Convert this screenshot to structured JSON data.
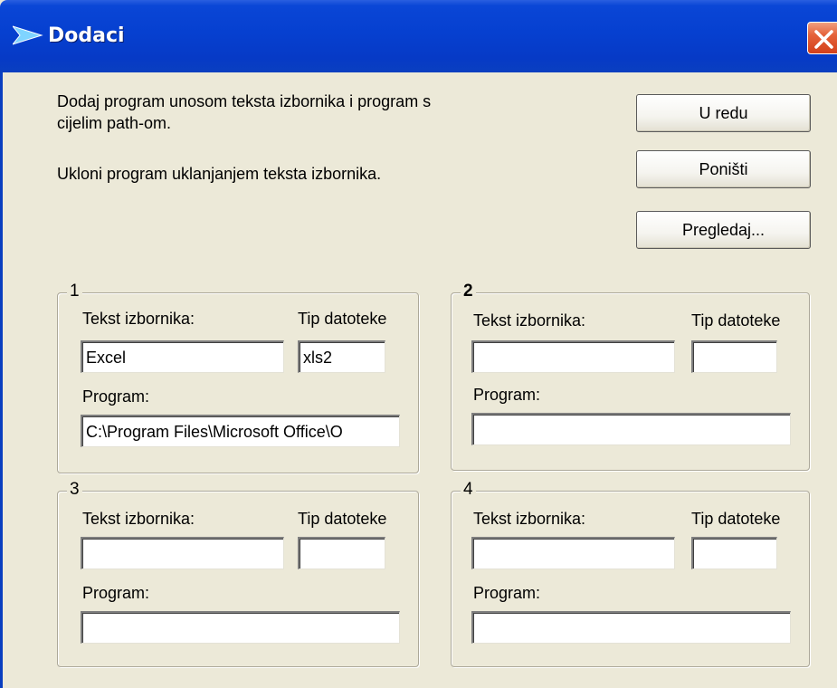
{
  "window": {
    "title": "Dodaci"
  },
  "info": {
    "line1": "Dodaj program unosom teksta izbornika i program s",
    "line2": "cijelim path-om.",
    "line3": "Ukloni program uklanjanjem teksta izbornika."
  },
  "buttons": {
    "ok": "U redu",
    "cancel": "Poništi",
    "browse": "Pregledaj..."
  },
  "groups": [
    {
      "number": "1",
      "menu_label": "Tekst izbornika:",
      "type_label": "Tip datoteke",
      "program_label": "Program:",
      "menu_value": "Excel",
      "type_value": "xls2",
      "program_value": "C:\\Program Files\\Microsoft Office\\O"
    },
    {
      "number": "2",
      "menu_label": "Tekst izbornika:",
      "type_label": "Tip datoteke",
      "program_label": "Program:",
      "menu_value": "",
      "type_value": "",
      "program_value": ""
    },
    {
      "number": "3",
      "menu_label": "Tekst izbornika:",
      "type_label": "Tip datoteke",
      "program_label": "Program:",
      "menu_value": "",
      "type_value": "",
      "program_value": ""
    },
    {
      "number": "4",
      "menu_label": "Tekst izbornika:",
      "type_label": "Tip datoteke",
      "program_label": "Program:",
      "menu_value": "",
      "type_value": "",
      "program_value": ""
    }
  ],
  "icons": {
    "title": "arrow-icon",
    "close": "close-icon"
  },
  "colors": {
    "titlebar": "#0640d0",
    "close": "#d3401b",
    "dialog": "#ece9d8"
  }
}
